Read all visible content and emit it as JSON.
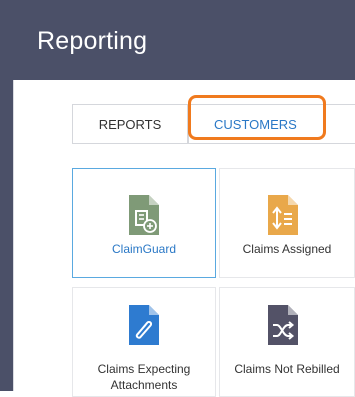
{
  "header": {
    "title": "Reporting"
  },
  "tabs": [
    {
      "label": "REPORTS"
    },
    {
      "label": "CUSTOMERS"
    }
  ],
  "tiles": [
    {
      "label": "ClaimGuard",
      "icon": "claimguard-icon",
      "color": "#7f9a77",
      "selected": true
    },
    {
      "label": "Claims Assigned",
      "icon": "claims-assigned-icon",
      "color": "#e9a84a",
      "selected": false
    },
    {
      "label": "Claims Expecting\nAttachments",
      "icon": "attachment-icon",
      "color": "#2e7bd0",
      "selected": false
    },
    {
      "label": "Claims Not Rebilled",
      "icon": "shuffle-icon",
      "color": "#535267",
      "selected": false
    }
  ],
  "colors": {
    "header_bg": "#4b5068",
    "accent": "#2a78c6",
    "highlight": "#f07a1e",
    "selected_border": "#5aa9e0"
  }
}
